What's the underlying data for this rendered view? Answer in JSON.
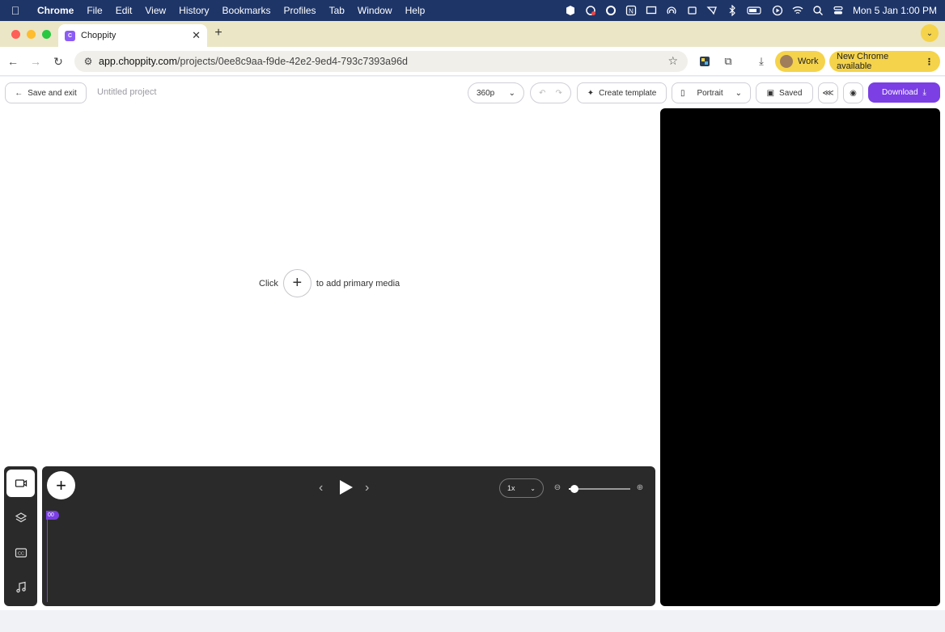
{
  "menubar": {
    "app_name": "Chrome",
    "items": [
      "File",
      "Edit",
      "View",
      "History",
      "Bookmarks",
      "Profiles",
      "Tab",
      "Window",
      "Help"
    ],
    "clock": "Mon 5 Jan  1:00 PM"
  },
  "browser": {
    "tab_title": "Choppity",
    "url_host": "app.choppity.com",
    "url_path": "/projects/0ee8c9aa-f9de-42e2-9ed4-793c7393a96d",
    "profile_label": "Work",
    "update_label": "New Chrome available",
    "colors": {
      "tabstrip": "#ebe6c5",
      "chip": "#f5d34a",
      "menubar": "#1e3568"
    }
  },
  "app": {
    "save_exit_label": "Save and exit",
    "project_title": "Untitled project",
    "resolution": "360p",
    "create_template_label": "Create template",
    "orientation": "Portrait",
    "saved_label": "Saved",
    "download_label": "Download",
    "empty_prefix": "Click",
    "empty_suffix": "to add primary media",
    "accent_color": "#7b3fe4"
  },
  "timeline": {
    "speed": "1x",
    "playhead_label": "00",
    "zoom_level": 0.09
  }
}
